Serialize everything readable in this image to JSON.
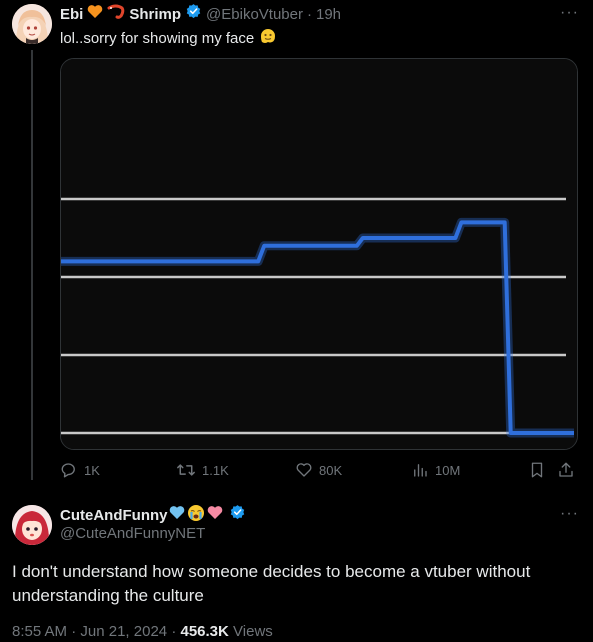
{
  "tweet": {
    "author_name_1": "Ebi",
    "author_name_2": "Shrimp",
    "handle": "@EbikoVtuber",
    "time": "19h",
    "text": "lol..sorry for showing my face",
    "icons": [
      "orange-heart",
      "shrimp",
      "verified-badge",
      "melting-face"
    ],
    "actions": {
      "replies": "1K",
      "reposts": "1.1K",
      "likes": "80K",
      "views": "10M"
    }
  },
  "chart_data": {
    "type": "line",
    "title": "",
    "xlabel": "",
    "ylabel": "",
    "grid": true,
    "ylim": [
      0,
      4
    ],
    "x": [
      0,
      1,
      2,
      3,
      4,
      5,
      6,
      7,
      8,
      9,
      10
    ],
    "series": [
      {
        "values": [
          2.2,
          2.2,
          2.2,
          2.2,
          2.4,
          2.4,
          2.5,
          2.5,
          2.7,
          0.0,
          0.0
        ]
      }
    ],
    "line_color": "#2f6fdc",
    "grid_color": "#c9c9c9",
    "background": "#0b0b0b"
  },
  "reply": {
    "author_name": "CuteAndFunny",
    "handle": "@CuteAndFunnyNET",
    "icons": [
      "light-blue-heart",
      "crying-face",
      "pink-heart",
      "verified-badge"
    ],
    "text": "I don't understand how someone decides to become a vtuber without understanding the culture",
    "time": "8:55 AM",
    "date": "Jun 21, 2024",
    "views_count": "456.3K",
    "views_label": "Views"
  },
  "more_label": "···",
  "separator": "·",
  "colors": {
    "accent": "#1d9bf0",
    "muted": "#71767b",
    "text": "#e7e9ea"
  }
}
